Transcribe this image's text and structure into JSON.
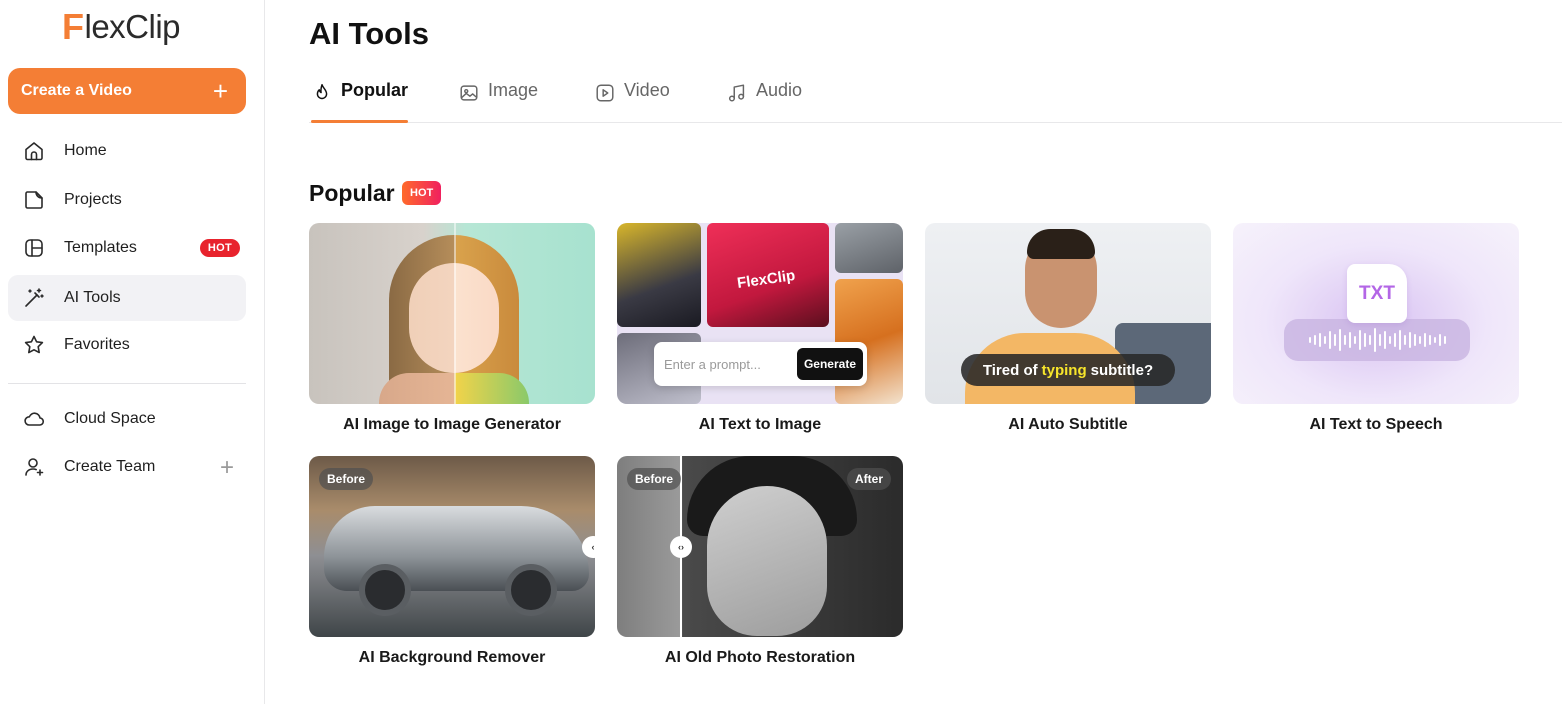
{
  "brand": {
    "logo_f": "F",
    "logo_rest": "lexClip",
    "accent": "#f47e35"
  },
  "sidebar": {
    "create_label": "Create a Video",
    "create_plus": "+",
    "items": [
      {
        "label": "Home",
        "icon": "home-icon"
      },
      {
        "label": "Projects",
        "icon": "projects-icon"
      },
      {
        "label": "Templates",
        "icon": "templates-icon",
        "badge": "HOT"
      },
      {
        "label": "AI Tools",
        "icon": "magic-wand-icon",
        "active": true
      },
      {
        "label": "Favorites",
        "icon": "star-icon"
      },
      {
        "label": "Cloud Space",
        "icon": "cloud-icon"
      },
      {
        "label": "Create Team",
        "icon": "user-add-icon",
        "plus": "+"
      }
    ]
  },
  "main": {
    "title": "AI Tools",
    "tabs": [
      {
        "label": "Popular",
        "icon": "fire-icon",
        "active": true
      },
      {
        "label": "Image",
        "icon": "image-icon"
      },
      {
        "label": "Video",
        "icon": "video-play-icon"
      },
      {
        "label": "Audio",
        "icon": "music-note-icon"
      }
    ],
    "section": {
      "title": "Popular",
      "badge": "HOT"
    },
    "cards": [
      {
        "label": "AI Image to Image Generator"
      },
      {
        "label": "AI Text to Image",
        "prompt_placeholder": "Enter a prompt...",
        "button": "Generate",
        "poster_text": "FlexClip"
      },
      {
        "label": "AI Auto Subtitle",
        "caption_pre": "Tired of",
        "caption_highlight": "typing",
        "caption_post": "subtitle?"
      },
      {
        "label": "AI Text to Speech",
        "doc_text": "TXT"
      },
      {
        "label": "AI Background Remover",
        "before_tag": "Before"
      },
      {
        "label": "AI Old Photo Restoration",
        "before_tag": "Before",
        "after_tag": "After"
      }
    ]
  }
}
